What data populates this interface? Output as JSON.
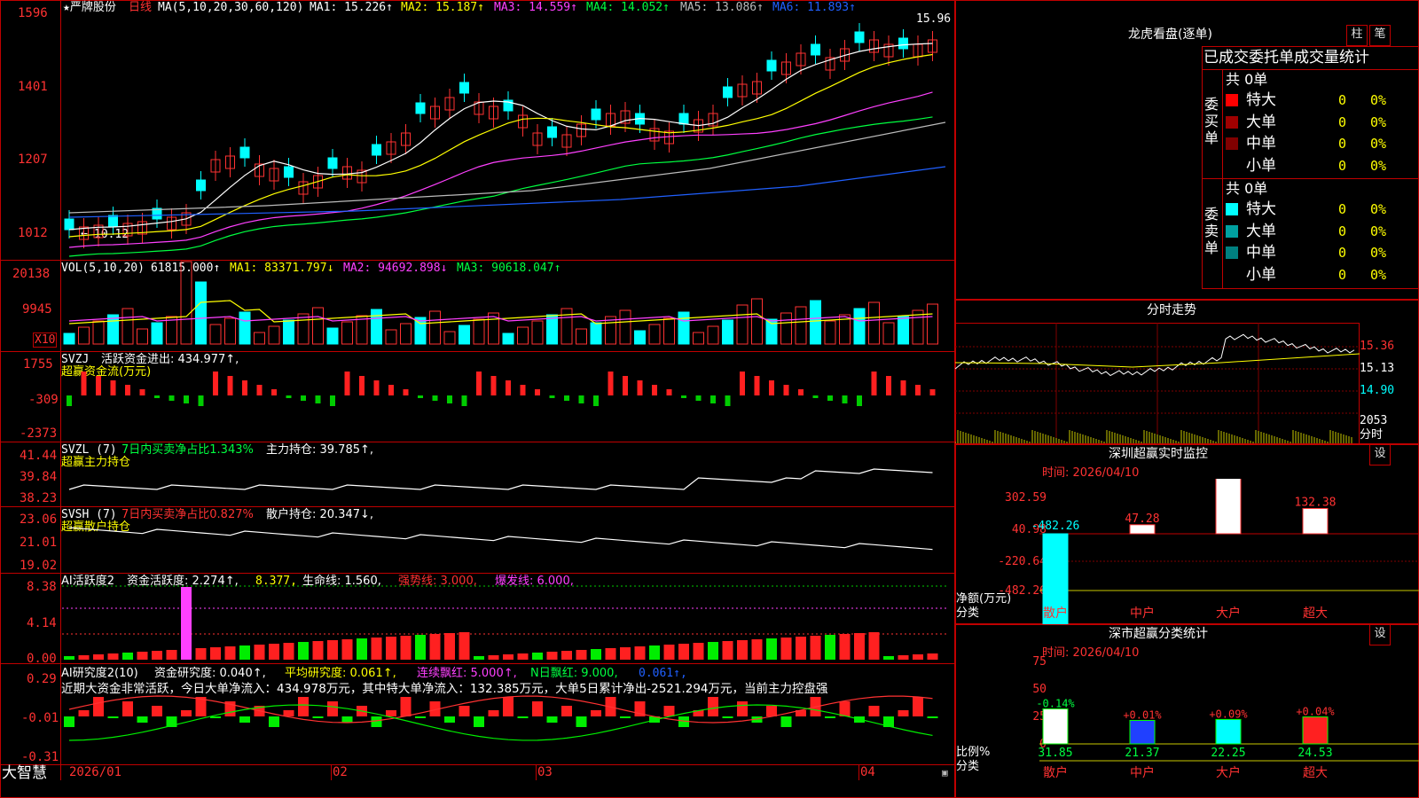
{
  "stock": {
    "name": "★严牌股份",
    "period": "日线",
    "ma_title": "MA(5,10,20,30,60,120)",
    "ma": [
      "MA1: 15.226↑",
      "MA2: 15.187↑",
      "MA3: 14.559↑",
      "MA4: 14.052↑",
      "MA5: 13.086↑",
      "MA6: 11.893↑"
    ],
    "high_label": "15.96",
    "low_label": "10.12",
    "price_axis": [
      "1596",
      "1401",
      "1207",
      "1012"
    ]
  },
  "volume": {
    "title": "VOL(5,10,20)",
    "vol": "61815.000↑",
    "ma1": "MA1: 83371.797↓",
    "ma2": "MA2: 94692.898↓",
    "ma3": "MA3: 90618.047↑",
    "axis": [
      "20138",
      "9945"
    ],
    "unit": "X10"
  },
  "svzj": {
    "title": "SVZJ",
    "desc": "活跃资金进出: 434.977↑,",
    "sub": "超赢资金流(万元)",
    "axis": [
      "1755",
      "-309",
      "-2373"
    ]
  },
  "svzl": {
    "title": "SVZL (7)",
    "desc1": "7日内买卖净占比1.343%",
    "desc2": "主力持仓: 39.785↑,",
    "sub": "超赢主力持仓",
    "axis": [
      "41.44",
      "39.84",
      "38.23"
    ]
  },
  "svsh": {
    "title": "SVSH (7)",
    "desc1": "7日内买卖净占比0.827%",
    "desc2": "散户持仓: 20.347↓,",
    "sub": "超赢散户持仓",
    "axis": [
      "23.06",
      "21.01",
      "19.02"
    ]
  },
  "ai1": {
    "title": "AI活跃度2",
    "d1": "资金活跃度: 2.274↑,",
    "d2": "8.377,",
    "d3": "生命线: 1.560,",
    "d4": "强势线: 3.000,",
    "d5": "爆发线: 6.000,",
    "axis": [
      "8.38",
      "4.14",
      "0.00"
    ]
  },
  "ai2": {
    "title": "AI研究度2(10)",
    "d1": "资金研究度: 0.040↑,",
    "d2": "平均研究度: 0.061↑,",
    "d3": "连续飘红: 5.000↑,",
    "d4": "N日飘红: 9.000,",
    "d5": "0.061↑,",
    "comment": "近期大资金非常活跃，今日大单净流入：434.978万元，其中特大单净流入：132.385万元，大单5日累计净出-2521.294万元，当前主力控盘强",
    "axis": [
      "0.29",
      "-0.01",
      "-0.31"
    ]
  },
  "dates": [
    "2026/01",
    "02",
    "03",
    "04"
  ],
  "brand": "大智慧",
  "lhb": {
    "title": "龙虎看盘(逐单)",
    "btn1": "柱",
    "btn2": "笔",
    "header": "已成交委托单成交量统计",
    "buy_label": "委买单",
    "sell_label": "委卖单",
    "buy_total": "共 0单",
    "sell_total": "共 0单",
    "buy": [
      {
        "name": "特大",
        "v": "0",
        "p": "0%",
        "color": "#ff0000"
      },
      {
        "name": "大单",
        "v": "0",
        "p": "0%",
        "color": "#a00000"
      },
      {
        "name": "中单",
        "v": "0",
        "p": "0%",
        "color": "#800000"
      },
      {
        "name": "小单",
        "v": "0",
        "p": "0%",
        "color": "#000000"
      }
    ],
    "sell": [
      {
        "name": "特大",
        "v": "0",
        "p": "0%",
        "color": "#00ffff"
      },
      {
        "name": "大单",
        "v": "0",
        "p": "0%",
        "color": "#00a0a0"
      },
      {
        "name": "中单",
        "v": "0",
        "p": "0%",
        "color": "#008080"
      },
      {
        "name": "小单",
        "v": "0",
        "p": "0%",
        "color": "#000000"
      }
    ]
  },
  "intraday": {
    "title": "分时走势",
    "axis": [
      "15.36",
      "15.13",
      "14.90"
    ],
    "vol_label": "2053",
    "vol_unit": "分时"
  },
  "monitor": {
    "title": "深圳超赢实时监控",
    "btn": "设",
    "time": "时间: 2026/04/10",
    "axis": [
      "302.59",
      "40.98",
      "-220.64",
      "-482.26"
    ],
    "ylabel": "净额(万元)",
    "xlabel": "分类",
    "cats": [
      "散户",
      "中户",
      "大户",
      "超大"
    ],
    "values": [
      -482.26,
      47.28,
      302.59,
      132.38
    ],
    "value_labels": [
      "-482.26",
      "47.28",
      "302.59",
      "132.38"
    ]
  },
  "stats": {
    "title": "深市超赢分类统计",
    "btn": "设",
    "time": "时间: 2026/04/10",
    "axis": [
      "75",
      "50",
      "25",
      "0"
    ],
    "ylabel": "比例%",
    "xlabel": "分类",
    "cats": [
      "散户",
      "中户",
      "大户",
      "超大"
    ],
    "values": [
      31.85,
      21.37,
      22.25,
      24.53
    ],
    "changes": [
      "-0.14%",
      "+0.01%",
      "+0.09%",
      "+0.04%"
    ],
    "value_labels": [
      "31.85",
      "21.37",
      "22.25",
      "24.53"
    ]
  }
}
